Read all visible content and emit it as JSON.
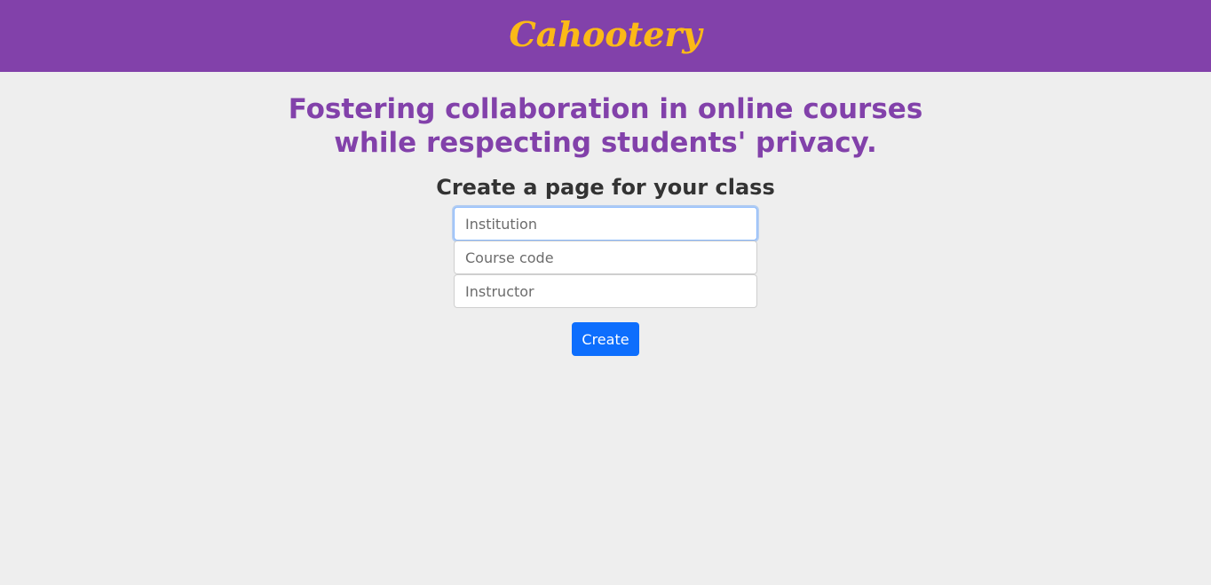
{
  "header": {
    "logo_text": "Cahootery"
  },
  "main": {
    "tagline_line1": "Fostering collaboration in online courses",
    "tagline_line2": "while respecting students' privacy.",
    "form_title": "Create a page for your class",
    "fields": [
      {
        "placeholder": "Institution",
        "value": ""
      },
      {
        "placeholder": "Course code",
        "value": ""
      },
      {
        "placeholder": "Instructor",
        "value": ""
      }
    ],
    "create_label": "Create"
  },
  "colors": {
    "header_bg": "#8241aa",
    "logo": "#fbb917",
    "tagline": "#8241aa",
    "page_bg": "#eeeeee",
    "button": "#0d6efd"
  }
}
